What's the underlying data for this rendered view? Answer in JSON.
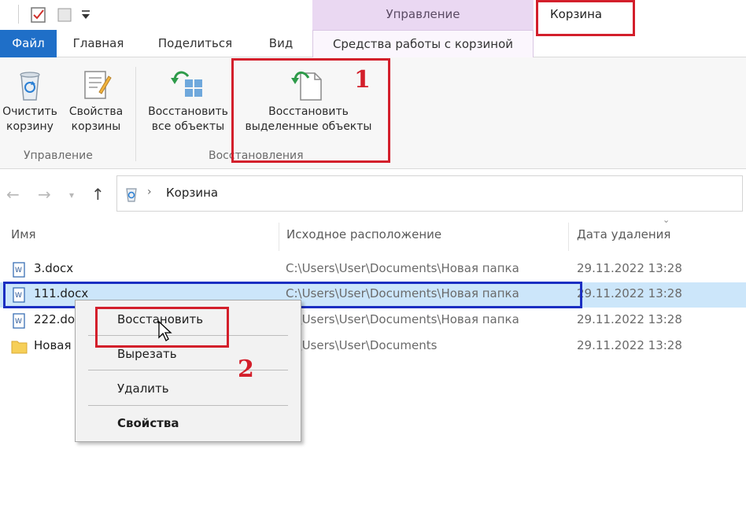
{
  "window": {
    "context_group": "Управление",
    "title": "Корзина"
  },
  "ribbon_tabs": {
    "file": "Файл",
    "home": "Главная",
    "share": "Поделиться",
    "view": "Вид",
    "recycle_tools": "Средства работы с корзиной"
  },
  "ribbon": {
    "empty_bin": [
      "Очистить",
      "корзину"
    ],
    "bin_properties": [
      "Свойства",
      "корзины"
    ],
    "manage_group": "Управление",
    "restore_all": [
      "Восстановить",
      "все объекты"
    ],
    "restore_selected": [
      "Восстановить",
      "выделенные объекты"
    ],
    "restore_group": "Восстановления"
  },
  "address": {
    "path": "Корзина"
  },
  "columns": {
    "name": "Имя",
    "original_location": "Исходное расположение",
    "date_deleted": "Дата удаления"
  },
  "files": [
    {
      "name": "3.docx",
      "location": "C:\\Users\\User\\Documents\\Новая папка",
      "date": "29.11.2022 13:28",
      "icon": "word-doc-icon"
    },
    {
      "name": "111.docx",
      "location": "C:\\Users\\User\\Documents\\Новая папка",
      "date": "29.11.2022 13:28",
      "icon": "word-doc-icon"
    },
    {
      "name": "222.docx",
      "location": "C:\\Users\\User\\Documents\\Новая папка",
      "date": "29.11.2022 13:28",
      "icon": "word-doc-icon"
    },
    {
      "name": "Новая",
      "location": "C:\\Users\\User\\Documents",
      "date": "29.11.2022 13:28",
      "icon": "folder-icon"
    }
  ],
  "context_menu": {
    "restore": "Восстановить",
    "cut": "Вырезать",
    "delete": "Удалить",
    "properties": "Свойства"
  },
  "annotations": {
    "step1": "1",
    "step2": "2"
  },
  "colors": {
    "file_tab": "#1f6fc8",
    "context_tab": "#ead8f2",
    "selection": "#cce6fa",
    "annotation_red": "#d31f2b",
    "annotation_blue": "#1b2fc2"
  }
}
